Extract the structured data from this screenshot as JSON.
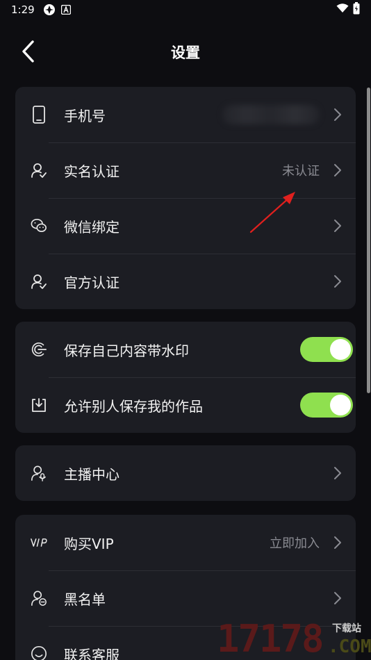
{
  "status_bar": {
    "time": "1:29"
  },
  "header": {
    "title": "设置"
  },
  "groups": {
    "account": {
      "phone": {
        "label": "手机号"
      },
      "realname": {
        "label": "实名认证",
        "value": "未认证"
      },
      "wechat": {
        "label": "微信绑定"
      },
      "official": {
        "label": "官方认证"
      }
    },
    "privacy": {
      "watermark": {
        "label": "保存自己内容带水印",
        "enabled": true
      },
      "allow_save": {
        "label": "允许别人保存我的作品",
        "enabled": true
      }
    },
    "creator": {
      "anchor": {
        "label": "主播中心"
      }
    },
    "more": {
      "vip": {
        "label": "购买VIP",
        "value": "立即加入"
      },
      "blacklist": {
        "label": "黑名单"
      },
      "support": {
        "label": "联系客服"
      }
    }
  },
  "watermark_logo": {
    "digits": "17178",
    "tag": "下载站",
    "domain": ".COM"
  },
  "colors": {
    "background": "#0d0d11",
    "card": "#1c1d23",
    "toggle_on": "#8fe04f",
    "annotation_arrow": "#e0201e"
  }
}
